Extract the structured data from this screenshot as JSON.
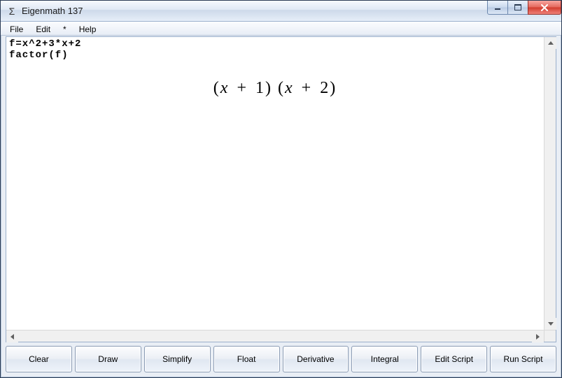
{
  "window": {
    "title": "Eigenmath 137",
    "icon_glyph": "Σ"
  },
  "menu": {
    "items": [
      "File",
      "Edit",
      "*",
      "Help"
    ]
  },
  "output": {
    "lines": [
      "f=x^2+3*x+2",
      "factor(f)"
    ],
    "result_math": "(x + 1) (x + 2)"
  },
  "buttons": {
    "items": [
      "Clear",
      "Draw",
      "Simplify",
      "Float",
      "Derivative",
      "Integral",
      "Edit Script",
      "Run Script"
    ]
  }
}
